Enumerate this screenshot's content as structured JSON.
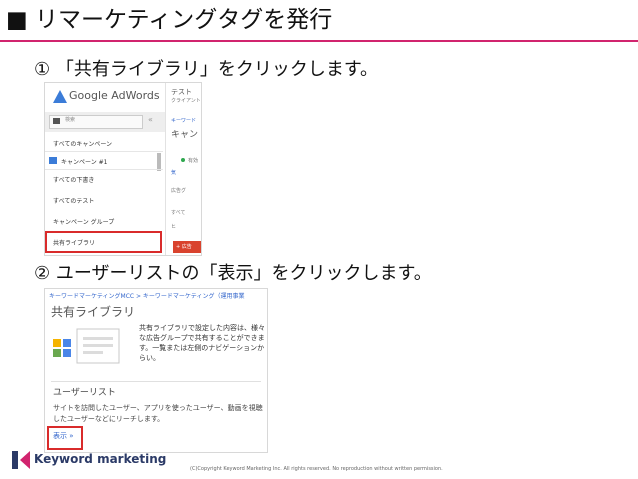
{
  "title": "■ リマーケティングタグを発行",
  "steps": {
    "step1": "① 「共有ライブラリ」をクリックします。",
    "step2": "② ユーザーリストの「表示」をクリックします。"
  },
  "shot1": {
    "app_name": "Google AdWords",
    "account_label": "テスト",
    "account_sub": "クライアント",
    "search_placeholder": "検索",
    "collapse": "«",
    "sidebar": [
      "すべてのキャンペーン",
      "キャンペーン #1",
      "すべての下書き",
      "すべてのテスト",
      "キャンペーン グループ",
      "共有ライブラリ"
    ],
    "right_labels": {
      "crumb": "キーワード",
      "heading": "キャン",
      "status": "有効",
      "blue": "気",
      "ad": "広告グ",
      "filter": "すべて",
      "chip": "ヒ",
      "button": "+ 広告"
    }
  },
  "shot2": {
    "breadcrumb": "キーワードマーケティングMCC > キーワードマーケティング（運用事業",
    "heading": "共有ライブラリ",
    "description": "共有ライブラリで設定した内容は、様々な広告グループで共有することができます。一覧または左側のナビゲーションからい。",
    "subheading": "ユーザーリスト",
    "body": "サイトを訪問したユーザー、アプリを使ったユーザー、動画を視聴したユーザーなどにリーチします。",
    "link": "表示 »"
  },
  "footer": {
    "logo_text": "Keyword marketing",
    "copyright": "(C)Copyright Keyword Marketing Inc. All rights reserved. No reproduction without written permission."
  }
}
